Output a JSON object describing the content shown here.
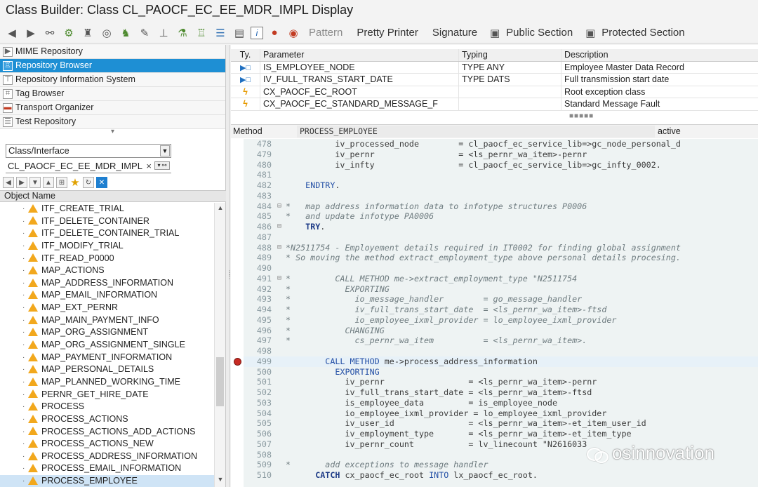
{
  "window": {
    "title": "Class Builder: Class CL_PAOCF_EC_EE_MDR_IMPL Display"
  },
  "toolbar": {
    "pattern_label": "Pattern",
    "pretty_printer_label": "Pretty Printer",
    "signature_label": "Signature",
    "public_section_label": "Public Section",
    "protected_section_label": "Protected Section"
  },
  "navigator": {
    "items": [
      {
        "label": "MIME Repository",
        "icon": "mime-repository-icon"
      },
      {
        "label": "Repository Browser",
        "icon": "repository-browser-icon"
      },
      {
        "label": "Repository Information System",
        "icon": "information-system-icon"
      },
      {
        "label": "Tag Browser",
        "icon": "tag-browser-icon"
      },
      {
        "label": "Transport Organizer",
        "icon": "transport-organizer-icon"
      },
      {
        "label": "Test Repository",
        "icon": "test-repository-icon"
      }
    ],
    "object_type_value": "Class/Interface",
    "object_name_value": "CL_PAOCF_EC_EE_MDR_IMPL",
    "clear_symbol": "×"
  },
  "object_tree": {
    "header": "Object Name",
    "rows": [
      "ITF_CREATE_TRIAL",
      "ITF_DELETE_CONTAINER",
      "ITF_DELETE_CONTAINER_TRIAL",
      "ITF_MODIFY_TRIAL",
      "ITF_READ_P0000",
      "MAP_ACTIONS",
      "MAP_ADDRESS_INFORMATION",
      "MAP_EMAIL_INFORMATION",
      "MAP_EXT_PERNR",
      "MAP_MAIN_PAYMENT_INFO",
      "MAP_ORG_ASSIGNMENT",
      "MAP_ORG_ASSIGNMENT_SINGLE",
      "MAP_PAYMENT_INFORMATION",
      "MAP_PERSONAL_DETAILS",
      "MAP_PLANNED_WORKING_TIME",
      "PERNR_GET_HIRE_DATE",
      "PROCESS",
      "PROCESS_ACTIONS",
      "PROCESS_ACTIONS_ADD_ACTIONS",
      "PROCESS_ACTIONS_NEW",
      "PROCESS_ADDRESS_INFORMATION",
      "PROCESS_EMAIL_INFORMATION",
      "PROCESS_EMPLOYEE"
    ],
    "selected_index": 22
  },
  "parameters": {
    "headers": {
      "type": "Ty.",
      "parameter": "Parameter",
      "typing": "Typing",
      "description": "Description"
    },
    "rows": [
      {
        "kind": "importing",
        "name": "IS_EMPLOYEE_NODE",
        "typing": "TYPE ANY",
        "description": "Employee Master Data Record"
      },
      {
        "kind": "importing",
        "name": "IV_FULL_TRANS_START_DATE",
        "typing": "TYPE DATS",
        "description": "Full transmission start date"
      },
      {
        "kind": "exception",
        "name": "CX_PAOCF_EC_ROOT",
        "typing": "",
        "description": "Root exception class"
      },
      {
        "kind": "exception",
        "name": "CX_PAOCF_EC_STANDARD_MESSAGE_F",
        "typing": "",
        "description": "Standard Message Fault"
      }
    ]
  },
  "method_bar": {
    "label": "Method",
    "method_name": "PROCESS_EMPLOYEE",
    "status": "active"
  },
  "code": {
    "lines": [
      {
        "n": "478",
        "fold": "",
        "text": "          iv_processed_node        = cl_paocf_ec_service_lib=>gc_node_personal_d",
        "type": "code"
      },
      {
        "n": "479",
        "fold": "",
        "text": "          iv_pernr                 = <ls_pernr_wa_item>-pernr",
        "type": "code"
      },
      {
        "n": "480",
        "fold": "",
        "text": "          iv_infty                 = cl_paocf_ec_service_lib=>gc_infty_0002.",
        "type": "code"
      },
      {
        "n": "481",
        "fold": "",
        "text": "",
        "type": "code"
      },
      {
        "n": "482",
        "fold": "",
        "text": "    ENDTRY.",
        "type": "code"
      },
      {
        "n": "483",
        "fold": "",
        "text": "",
        "type": "code"
      },
      {
        "n": "484",
        "fold": "⊟",
        "text": "*   map address information data to infotype structures P0006",
        "type": "comment"
      },
      {
        "n": "485",
        "fold": "",
        "text": "*   and update infotype PA0006",
        "type": "comment"
      },
      {
        "n": "486",
        "fold": "⊟",
        "text": "    TRY.",
        "type": "code"
      },
      {
        "n": "487",
        "fold": "",
        "text": "",
        "type": "code"
      },
      {
        "n": "488",
        "fold": "⊟",
        "text": "*N2511754 - Employement details required in IT0002 for finding global assignment",
        "type": "comment"
      },
      {
        "n": "489",
        "fold": "",
        "text": "* So moving the method extract_employment_type above personal details procesing.",
        "type": "comment"
      },
      {
        "n": "490",
        "fold": "",
        "text": "",
        "type": "code"
      },
      {
        "n": "491",
        "fold": "⊟",
        "text": "*         CALL METHOD me->extract_employment_type \"N2511754",
        "type": "comment"
      },
      {
        "n": "492",
        "fold": "",
        "text": "*           EXPORTING",
        "type": "comment"
      },
      {
        "n": "493",
        "fold": "",
        "text": "*             io_message_handler        = go_message_handler",
        "type": "comment"
      },
      {
        "n": "494",
        "fold": "",
        "text": "*             iv_full_trans_start_date  = <ls_pernr_wa_item>-ftsd",
        "type": "comment"
      },
      {
        "n": "495",
        "fold": "",
        "text": "*             io_employee_ixml_provider = lo_employee_ixml_provider",
        "type": "comment"
      },
      {
        "n": "496",
        "fold": "",
        "text": "*           CHANGING",
        "type": "comment"
      },
      {
        "n": "497",
        "fold": "",
        "text": "*             cs_pernr_wa_item          = <ls_pernr_wa_item>.",
        "type": "comment"
      },
      {
        "n": "498",
        "fold": "",
        "text": "",
        "type": "code"
      },
      {
        "n": "499",
        "fold": "",
        "text": "        CALL METHOD me->process_address_information",
        "type": "current"
      },
      {
        "n": "500",
        "fold": "",
        "text": "          EXPORTING",
        "type": "code"
      },
      {
        "n": "501",
        "fold": "",
        "text": "            iv_pernr                 = <ls_pernr_wa_item>-pernr",
        "type": "code"
      },
      {
        "n": "502",
        "fold": "",
        "text": "            iv_full_trans_start_date = <ls_pernr_wa_item>-ftsd",
        "type": "code"
      },
      {
        "n": "503",
        "fold": "",
        "text": "            is_employee_data         = is_employee_node",
        "type": "code"
      },
      {
        "n": "504",
        "fold": "",
        "text": "            io_employee_ixml_provider = lo_employee_ixml_provider",
        "type": "code"
      },
      {
        "n": "505",
        "fold": "",
        "text": "            iv_user_id               = <ls_pernr_wa_item>-et_item_user_id",
        "type": "code"
      },
      {
        "n": "506",
        "fold": "",
        "text": "            iv_employment_type       = <ls_pernr_wa_item>-et_item_type",
        "type": "code"
      },
      {
        "n": "507",
        "fold": "",
        "text": "            iv_pernr_count           = lv_linecount \"N2616033",
        "type": "code"
      },
      {
        "n": "508",
        "fold": "",
        "text": "",
        "type": "code"
      },
      {
        "n": "509",
        "fold": "",
        "text": "*       add exceptions to message handler",
        "type": "comment"
      },
      {
        "n": "510",
        "fold": "",
        "text": "      CATCH cx_paocf_ec_root INTO lx_paocf_ec_root.",
        "type": "code"
      }
    ],
    "breakpoint_line": "499"
  },
  "watermark": {
    "text": "osinnovation"
  }
}
